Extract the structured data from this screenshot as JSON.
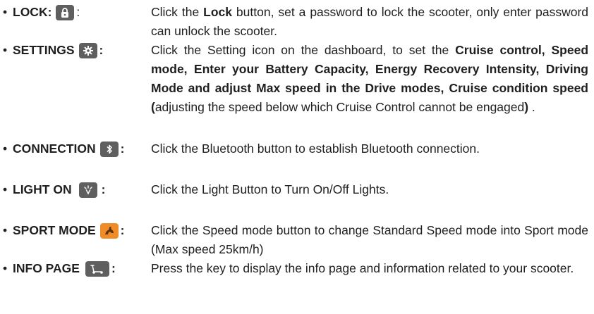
{
  "items": [
    {
      "label": "LOCK",
      "sep": ": ",
      "icon": "lock-icon",
      "desc": [
        {
          "t": "Click the ",
          "b": false
        },
        {
          "t": "Lock",
          "b": true
        },
        {
          "t": " button, set a password to lock the scooter, only enter password can unlock the scooter.",
          "b": false
        }
      ]
    },
    {
      "label": "SETTINGS",
      "sep": ":",
      "icon": "gear-icon",
      "desc": [
        {
          "t": "Click the Setting icon on the dashboard, to set the ",
          "b": false
        },
        {
          "t": "Cruise control, Speed mode, Enter your Battery Capacity, Energy Recovery Intensity, Driving Mode and adjust Max speed in the Drive modes, Cruise condition speed (",
          "b": true
        },
        {
          "t": "adjusting the speed below which Cruise Control cannot be engaged",
          "b": false
        },
        {
          "t": ")",
          "b": true
        },
        {
          "t": " .",
          "b": false
        }
      ]
    },
    {
      "label": "CONNECTION",
      "sep": ":",
      "icon": "bluetooth-icon",
      "desc": [
        {
          "t": "Click the Bluetooth button to establish Bluetooth connection.",
          "b": false
        }
      ]
    },
    {
      "label": "LIGHT ON",
      "sep": ":",
      "icon": "light-icon",
      "desc": [
        {
          "t": "Click the Light Button to Turn On/Off Lights.",
          "b": false
        }
      ]
    },
    {
      "label": "SPORT MODE",
      "sep": ":",
      "icon": "sport-mode-icon",
      "desc": [
        {
          "t": "Click the Speed mode button to change Standard Speed mode into Sport mode (Max speed 25km/h)",
          "b": false
        }
      ]
    },
    {
      "label": "INFO PAGE",
      "sep": ":",
      "icon": "scooter-info-icon",
      "desc": [
        {
          "t": "Press the key to display the info page and information related to your scooter.",
          "b": false
        }
      ]
    }
  ],
  "colors": {
    "icon_bg": "#5f5f5f",
    "sport_icon_bg": "#f08c28",
    "text": "#1f1f1f"
  }
}
